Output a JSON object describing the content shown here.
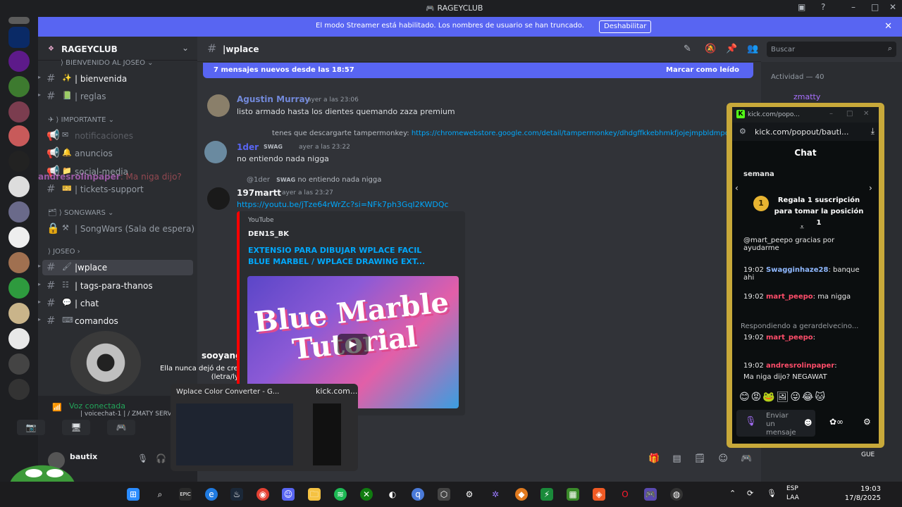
{
  "window": {
    "title": "RAGEYCLUB"
  },
  "banner": {
    "message": "El modo Streamer está habilitado. Los nombres de usuario se han truncado.",
    "button": "Deshabilitar"
  },
  "server": {
    "name": "RAGEYCLUB"
  },
  "sidebar": {
    "cat_bienvenido": "⟩ BIENVENIDO AL JOSEO ⌄",
    "cat_importante": "✈ ⟩ IMPORTANTE ⌄",
    "cat_songwars": "🗂 ⟩ SONGWARS ⌄",
    "cat_joseo": "⟩ JOSEO ›",
    "channels": {
      "bienvenida": "| bienvenida",
      "reglas": "| reglas",
      "notificaciones": "notificaciones",
      "anuncios": "anuncios",
      "social": "social-media",
      "tickets": "| tickets-support",
      "songwars": "| SongWars (Sala de espera)",
      "wplace": "|wplace",
      "tags": "| tags-para-thanos",
      "chat": "| chat",
      "comandos": "comandos"
    },
    "ghost_user": "andresrolinpaper",
    "ghost_text": ": Ma niga dijo?"
  },
  "voice": {
    "status": "Voz conectada",
    "channel": "| voicechat-1 | / ZMATY SERVER",
    "username": "bautix"
  },
  "header": {
    "channel": "|wplace",
    "search_placeholder": "Buscar"
  },
  "newbar": {
    "left": "7 mensajes nuevos desde las 18:57",
    "right": "Marcar como leído"
  },
  "messages": {
    "m1": {
      "author": "Agustin Murray",
      "time": "ayer a las 23:06",
      "text": "listo armado hasta los dientes quemando zaza premium"
    },
    "m2": {
      "reply": "tenes que descargarte tampermonkey:",
      "reply_link": "https://chromewebstore.google.com/detail/tampermonkey/dhdgffkkebhmkfjojejmpbldmpobfkfo?hl=es ...",
      "author": "1der",
      "tag": "SWAG",
      "time": "ayer a las 23:22",
      "text": "no entiendo nada nigga"
    },
    "m3": {
      "reply_user": "@1der",
      "reply_tag": "SWAG",
      "reply": "no entiendo nada nigga",
      "author": "197martt",
      "time": "ayer a las 23:27",
      "link": "https://youtu.be/jTze64rWrZc?si=NFk7ph3GqI2KWDQc"
    },
    "embed": {
      "provider": "YouTube",
      "author": "DEN1S_BK",
      "title": "EXTENSIO PARA DIBUJAR WPLACE FACIL BLUE MARBEL / WPLACE DRAWING EXT...",
      "thumb_text": "Blue Marble Tutorial"
    }
  },
  "members": {
    "heading": "Actividad — 40",
    "first": "zmatty",
    "last": "GUE"
  },
  "kick": {
    "window_url": "kick.com/popo...",
    "address": "kick.com/popout/bauti...",
    "chat_title": "Chat",
    "fade_line": "semana",
    "promo_rank": "1",
    "promo": "Regala 1 suscripción para tomar la posición 1",
    "messages": [
      {
        "time": "",
        "user": "",
        "text": "@mart_peepo gracias por ayudarme"
      },
      {
        "time": "19:02",
        "user": "Swagginhaze28",
        "text": ": banque ahi"
      },
      {
        "time": "19:02",
        "user": "mart_peepo",
        "text": ": ma nigga"
      },
      {
        "time": "",
        "user": "",
        "text": "Respondiendo a gerardelvecino..."
      },
      {
        "time": "19:02",
        "user": "mart_peepo",
        "text": ":"
      },
      {
        "time": "19:02",
        "user": "andresrolinpaper",
        "text": ":"
      },
      {
        "time": "",
        "user": "",
        "text": "Ma niga dijo? NEGAWAT"
      }
    ],
    "send_placeholder": "Enviar un mensaje",
    "user_colors": {
      "Swagginhaze28": "#8fb8ff",
      "mart_peepo": "#ff4d6a",
      "andresrolinpaper": "#ff4d6a"
    }
  },
  "nowplaying": {
    "title": "sooyangel",
    "subtitle": "Ella nunca dejó de creer, siempre tuvo fe (letra/lyrics)"
  },
  "thumbs": {
    "left": "Wplace Color Converter - G...",
    "right": "kick.com..."
  },
  "taskbar": {
    "lang1": "ESP",
    "lang2": "LAA",
    "time": "19:03",
    "date": "17/8/2025"
  }
}
